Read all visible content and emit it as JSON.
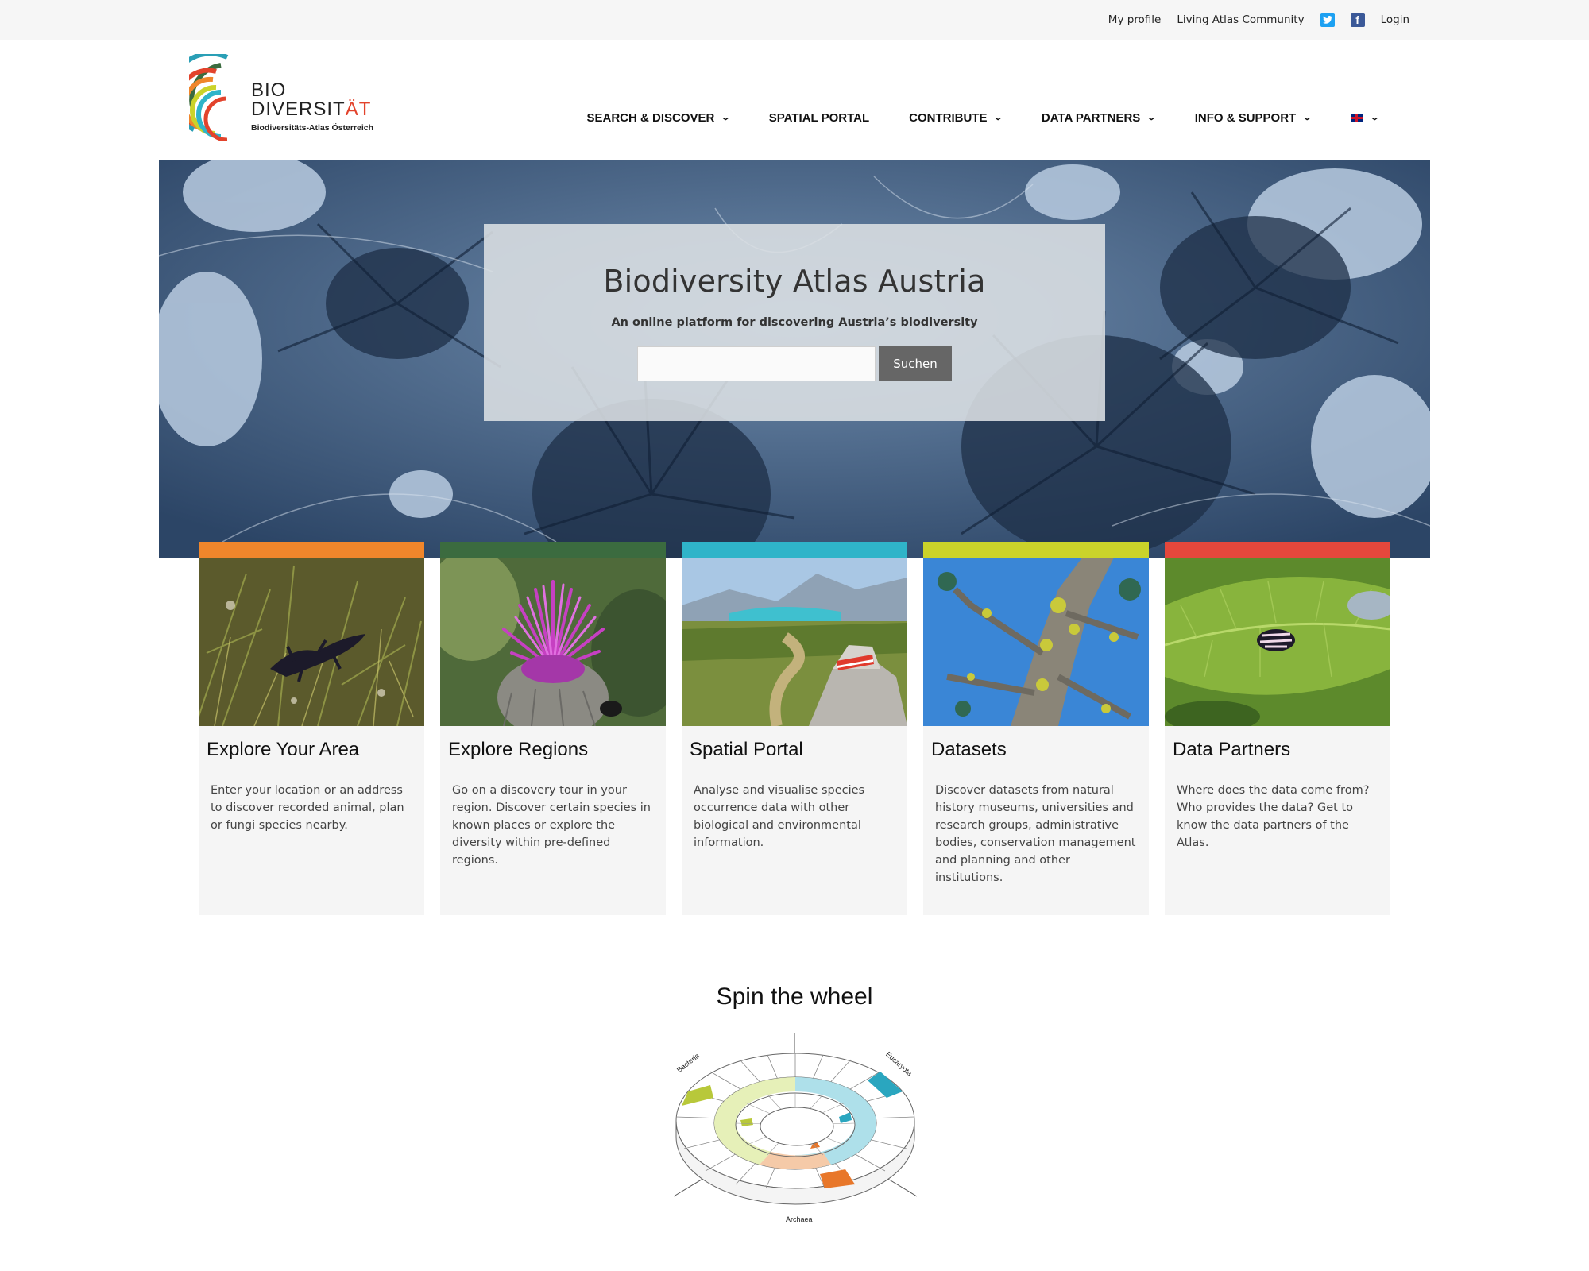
{
  "topbar": {
    "my_profile": "My profile",
    "community": "Living Atlas Community",
    "twitter_icon": "twitter-icon",
    "facebook_icon": "facebook-icon",
    "login": "Login"
  },
  "logo": {
    "line1": "BIO",
    "line2a": "DIVERSIT",
    "line2b": "ÄT",
    "subtitle": "Biodiversitäts-Atlas Österreich"
  },
  "nav": {
    "search": "SEARCH & DISCOVER",
    "spatial": "SPATIAL PORTAL",
    "contribute": "CONTRIBUTE",
    "partners": "DATA PARTNERS",
    "info": "INFO & SUPPORT",
    "language_icon": "uk-flag-icon"
  },
  "hero": {
    "title": "Biodiversity Atlas Austria",
    "subtitle": "An online platform for discovering Austria’s biodiversity",
    "search_value": "",
    "search_button": "Suchen"
  },
  "cards": [
    {
      "title": "Explore Your Area",
      "text": "Enter your location or an address to discover recorded animal, plan or fungi species nearby.",
      "color": "#f0862b"
    },
    {
      "title": "Explore Regions",
      "text": "Go on a discovery tour in your region. Discover certain species in known places or explore the diversity within pre-defined regions.",
      "color": "#3b6b3f"
    },
    {
      "title": "Spatial Portal",
      "text": "Analyse and visualise species occurrence data with other biological and environmental information.",
      "color": "#2fb4c9"
    },
    {
      "title": "Datasets",
      "text": "Discover datasets from natural history museums, universities and research groups, administrative bodies, conservation management and planning and other institutions.",
      "color": "#cbd32a"
    },
    {
      "title": "Data Partners",
      "text": "Where does the data come from? Who provides the data? Get to know the data partners of the Atlas.",
      "color": "#e4473c"
    }
  ],
  "wheel": {
    "title": "Spin the wheel",
    "label_bacteria": "Bacteria",
    "label_eucaryota": "Eucaryota",
    "label_archaea": "Archaea"
  }
}
